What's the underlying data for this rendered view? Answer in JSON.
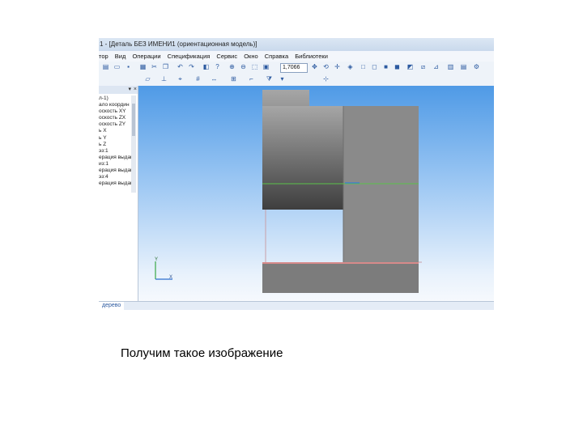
{
  "window": {
    "title": "1 - [Деталь БЕЗ ИМЕНИ1 (ориентационная модель)]"
  },
  "menu": [
    "тор",
    "Вид",
    "Операции",
    "Спецификация",
    "Сервис",
    "Окно",
    "Справка",
    "Библиотеки"
  ],
  "toolbar": {
    "zoom_value": "1,7066"
  },
  "tree": {
    "rows": [
      "л-1)",
      "ало координ",
      "оскость XY",
      "оскость ZX",
      "оскость ZY",
      "ь X",
      "ь Y",
      "ь Z",
      "эз:1",
      "ерация выдав",
      "из:1",
      "ерация выдав",
      "эз:4",
      "ерация выдав"
    ]
  },
  "panel_tab": "дерево",
  "axes": {
    "x_label": "X",
    "y_label": "Y"
  },
  "caption": "Получим такое изображение"
}
